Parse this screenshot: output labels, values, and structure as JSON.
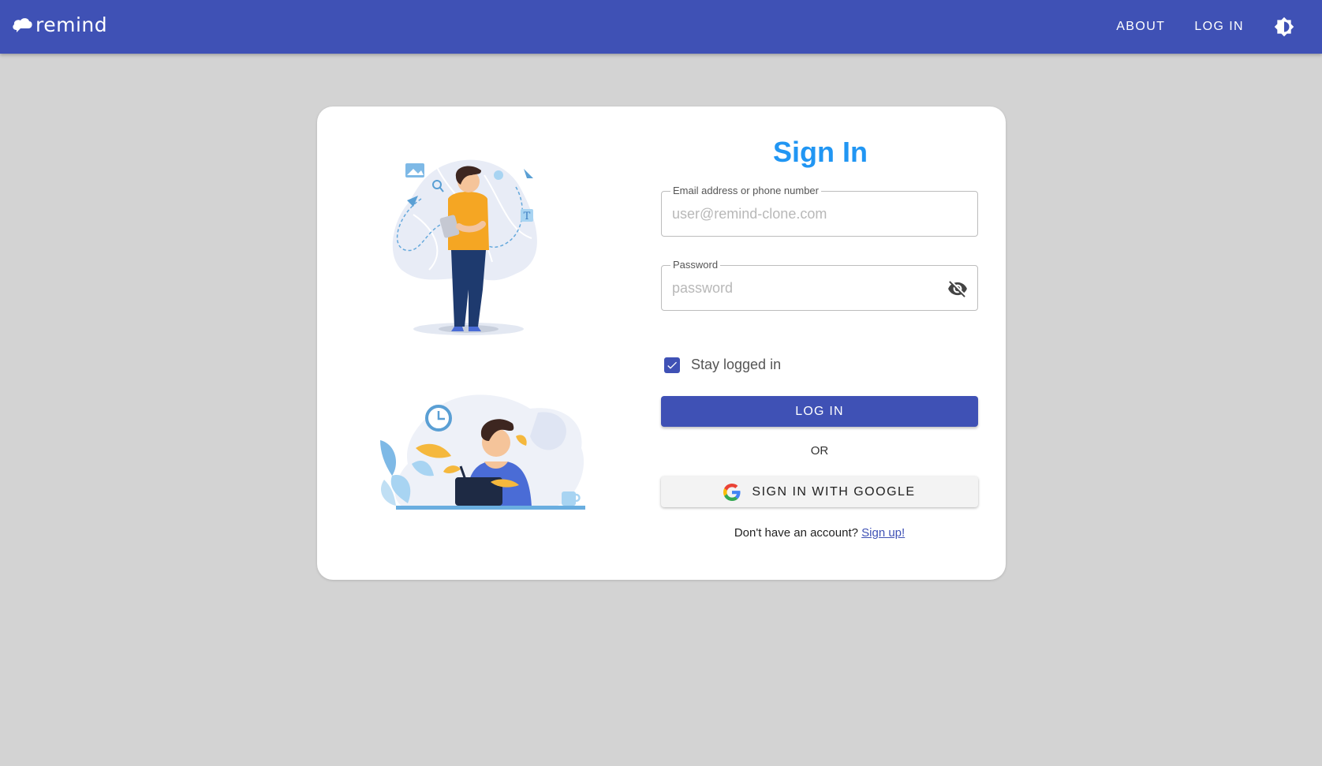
{
  "header": {
    "logo_text": "remind",
    "nav": {
      "about": "ABOUT",
      "login": "LOG IN"
    },
    "theme_icon": "brightness-icon"
  },
  "signin": {
    "title": "Sign In",
    "email": {
      "label": "Email address or phone number",
      "placeholder": "user@remind-clone.com",
      "value": ""
    },
    "password": {
      "label": "Password",
      "placeholder": "password",
      "value": "",
      "toggle_icon": "visibility-off-icon"
    },
    "stay_logged_in": {
      "label": "Stay logged in",
      "checked": true
    },
    "login_button": "LOG IN",
    "or_text": "OR",
    "google_button": "SIGN IN WITH GOOGLE",
    "google_icon": "google-icon",
    "signup": {
      "prompt": "Don't have an account?",
      "link": "Sign up!"
    }
  },
  "colors": {
    "primary": "#3f51b5",
    "title": "#2196f3",
    "background": "#d3d3d3"
  }
}
